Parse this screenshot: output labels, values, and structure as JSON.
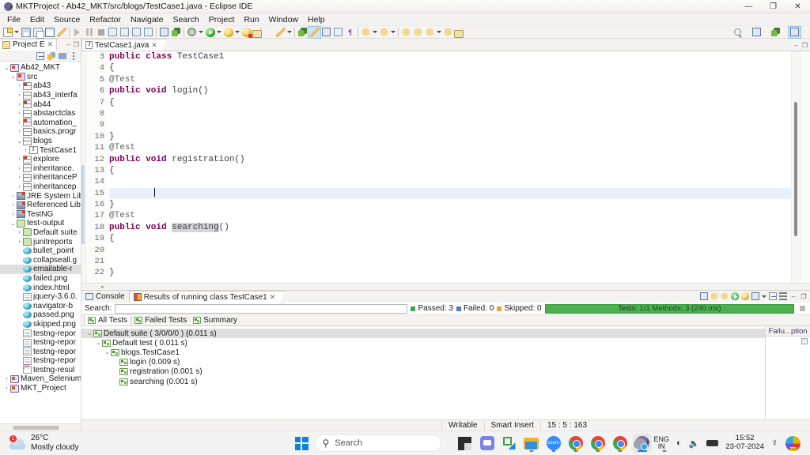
{
  "window": {
    "title": "MKTProject  -  Ab42_MKT/src/blogs/TestCase1.java  -  Eclipse IDE",
    "icon": "eclipse-icon",
    "minimize": "—",
    "restore": "❐",
    "close": "✕"
  },
  "menubar": {
    "items": [
      {
        "label": "File"
      },
      {
        "label": "Edit"
      },
      {
        "label": "Source"
      },
      {
        "label": "Refactor"
      },
      {
        "label": "Navigate"
      },
      {
        "label": "Search"
      },
      {
        "label": "Project"
      },
      {
        "label": "Run"
      },
      {
        "label": "Window"
      },
      {
        "label": "Help"
      }
    ]
  },
  "toolbar": {
    "groups": [
      {
        "items": [
          {
            "name": "new-wizard-icon",
            "kind": "doc",
            "arrow": true
          },
          {
            "name": "save-icon",
            "kind": "save"
          },
          {
            "name": "save-all-icon",
            "kind": "copy"
          },
          {
            "name": "toggle-window-icon",
            "kind": "win"
          },
          {
            "name": "print-icon",
            "kind": "pen"
          }
        ]
      },
      {
        "items": [
          {
            "name": "resume-icon",
            "kind": "play"
          },
          {
            "name": "suspend-icon",
            "kind": "pause"
          },
          {
            "name": "terminate-icon",
            "kind": "stop"
          },
          {
            "name": "step-into-icon",
            "kind": "box"
          },
          {
            "name": "step-over-icon",
            "kind": "box"
          },
          {
            "name": "step-return-icon",
            "kind": "box"
          },
          {
            "name": "drop-to-frame-icon",
            "kind": "box"
          }
        ]
      },
      {
        "items": [
          {
            "name": "open-task-icon",
            "kind": "boxb"
          },
          {
            "name": "search-task-icon",
            "kind": "leaf"
          }
        ]
      },
      {
        "items": [
          {
            "name": "external-tools-icon",
            "kind": "gear",
            "arrow": true
          },
          {
            "name": "run-icon",
            "kind": "green",
            "arrow": true
          },
          {
            "name": "debug-icon",
            "kind": "bug",
            "arrow": true
          },
          {
            "name": "coverage-icon",
            "kind": "bug-red",
            "arrow": true
          }
        ]
      },
      {
        "items": [
          {
            "name": "new-java-project-icon",
            "kind": "fold"
          },
          {
            "name": "new-java-package-icon",
            "kind": "pen",
            "arrow": true
          }
        ]
      },
      {
        "items": [
          {
            "name": "new-class-icon",
            "kind": "leaf"
          },
          {
            "name": "new-interface-icon",
            "kind": "pen",
            "selected": true
          },
          {
            "name": "new-enum-icon",
            "kind": "boxb"
          },
          {
            "name": "new-annotation-icon",
            "kind": "box"
          },
          {
            "name": "new-source-folder-icon",
            "kind": "t",
            "glyph": "¶"
          }
        ]
      },
      {
        "items": [
          {
            "name": "open-type-icon",
            "kind": "arrow-y",
            "arrow": true
          },
          {
            "name": "search-declaration-icon",
            "kind": "arrow-y",
            "arrow": true
          }
        ]
      },
      {
        "items": [
          {
            "name": "previous-annotation-icon",
            "kind": "arrow-y"
          },
          {
            "name": "next-annotation-icon",
            "kind": "arrow-y"
          },
          {
            "name": "back-icon",
            "kind": "arrow-y",
            "arrow": true
          },
          {
            "name": "forward-icon",
            "kind": "arrow-y",
            "arrow": true
          }
        ]
      },
      {
        "items": [
          {
            "name": "new-window-icon",
            "kind": "fold"
          }
        ]
      }
    ],
    "right": [
      {
        "name": "quick-access-search-icon",
        "kind": "mag"
      },
      {
        "name": "open-perspective-icon",
        "kind": "boxb"
      },
      {
        "name": "java-perspective-icon",
        "kind": "leaf"
      },
      {
        "name": "java-ee-perspective-icon",
        "kind": "boxb",
        "selected": true
      }
    ]
  },
  "explorer": {
    "tab": {
      "label": "Project E",
      "icon": "project-explorer-icon",
      "close": "✕"
    },
    "view_controls": [
      {
        "name": "minimize-view-icon",
        "glyph": "–"
      },
      {
        "name": "maximize-view-icon",
        "glyph": "❐"
      }
    ],
    "view_toolbar": [
      {
        "name": "collapse-all-icon",
        "kind": "collapse"
      },
      {
        "name": "link-with-editor-icon",
        "kind": "link"
      },
      {
        "name": "view-filters-icon",
        "kind": "filter"
      },
      {
        "name": "view-menu-icon",
        "kind": "vmenu"
      }
    ],
    "tree": [
      {
        "indent": 0,
        "twist": "v",
        "icon": "i-proj",
        "label": "Ab42_MKT"
      },
      {
        "indent": 1,
        "twist": "v",
        "icon": "i-src",
        "label": "src"
      },
      {
        "indent": 2,
        "twist": ">",
        "icon": "i-pkg hasred",
        "label": "ab43"
      },
      {
        "indent": 2,
        "twist": ">",
        "icon": "i-pkg",
        "label": "ab43_interfa"
      },
      {
        "indent": 2,
        "twist": ">",
        "icon": "i-pkg hasred",
        "label": "ab44"
      },
      {
        "indent": 2,
        "twist": ">",
        "icon": "i-pkg",
        "label": "abstarctclas"
      },
      {
        "indent": 2,
        "twist": ">",
        "icon": "i-pkg hasred",
        "label": "automation_"
      },
      {
        "indent": 2,
        "twist": ">",
        "icon": "i-pkg y",
        "label": "basics.progr"
      },
      {
        "indent": 2,
        "twist": "v",
        "icon": "i-pkg",
        "label": "blogs"
      },
      {
        "indent": 3,
        "twist": ">",
        "icon": "i-java",
        "label": "TestCase1"
      },
      {
        "indent": 2,
        "twist": ">",
        "icon": "i-pkg hasred",
        "label": "explore"
      },
      {
        "indent": 2,
        "twist": ">",
        "icon": "i-pkg",
        "label": "inheritance."
      },
      {
        "indent": 2,
        "twist": ">",
        "icon": "i-pkg",
        "label": "inheritanceP"
      },
      {
        "indent": 2,
        "twist": ">",
        "icon": "i-pkg",
        "label": "inheritancep"
      },
      {
        "indent": 1,
        "twist": ">",
        "icon": "i-lib",
        "label": "JRE System Libr"
      },
      {
        "indent": 1,
        "twist": ">",
        "icon": "i-lib",
        "label": "Referenced Lib"
      },
      {
        "indent": 1,
        "twist": ">",
        "icon": "i-lib",
        "label": "TestNG"
      },
      {
        "indent": 1,
        "twist": "v",
        "icon": "i-folder green",
        "label": "test-output"
      },
      {
        "indent": 2,
        "twist": ">",
        "icon": "i-folder green",
        "label": "Default suite"
      },
      {
        "indent": 2,
        "twist": ">",
        "icon": "i-folder green",
        "label": "junitreports"
      },
      {
        "indent": 2,
        "twist": "",
        "icon": "i-png",
        "label": "bullet_point"
      },
      {
        "indent": 2,
        "twist": "",
        "icon": "i-png",
        "label": "collapseall.g"
      },
      {
        "indent": 2,
        "twist": "",
        "icon": "i-png",
        "label": "emailable-r",
        "selected": true
      },
      {
        "indent": 2,
        "twist": "",
        "icon": "i-png",
        "label": "failed.png"
      },
      {
        "indent": 2,
        "twist": "",
        "icon": "i-png",
        "label": "index.html"
      },
      {
        "indent": 2,
        "twist": "",
        "icon": "i-html",
        "label": "jquery-3.6.0."
      },
      {
        "indent": 2,
        "twist": "",
        "icon": "i-png",
        "label": "navigator-b"
      },
      {
        "indent": 2,
        "twist": "",
        "icon": "i-png",
        "label": "passed.png"
      },
      {
        "indent": 2,
        "twist": "",
        "icon": "i-png",
        "label": "skipped.png"
      },
      {
        "indent": 2,
        "twist": "",
        "icon": "i-html",
        "label": "testng-repor"
      },
      {
        "indent": 2,
        "twist": "",
        "icon": "i-html",
        "label": "testng-repor"
      },
      {
        "indent": 2,
        "twist": "",
        "icon": "i-html",
        "label": "testng-repor"
      },
      {
        "indent": 2,
        "twist": "",
        "icon": "i-html",
        "label": "testng-repor"
      },
      {
        "indent": 2,
        "twist": "",
        "icon": "i-xml",
        "label": "testng-resul"
      },
      {
        "indent": 0,
        "twist": ">",
        "icon": "i-proj",
        "label": "Maven_Selenium"
      },
      {
        "indent": 0,
        "twist": ">",
        "icon": "i-proj",
        "label": "MKT_Project"
      }
    ]
  },
  "editor": {
    "tab": {
      "label": "TestCase1.java",
      "icon": "java-file-icon",
      "close": "✕"
    },
    "view_controls": [
      {
        "name": "minimize-editor-icon",
        "glyph": "–"
      },
      {
        "name": "maximize-editor-icon",
        "glyph": "❐"
      }
    ],
    "first_line_number": 3,
    "lines": [
      {
        "n": 3,
        "fold": "",
        "tokens": [
          {
            "t": "public class ",
            "c": "kw"
          },
          {
            "t": "TestCase1",
            "c": "id"
          }
        ]
      },
      {
        "n": 4,
        "fold": "",
        "tokens": [
          {
            "t": "{",
            "c": "id"
          }
        ]
      },
      {
        "n": 5,
        "fold": "●",
        "tokens": [
          {
            "t": "@Test",
            "c": "ann"
          }
        ]
      },
      {
        "n": 6,
        "fold": "",
        "tokens": [
          {
            "t": "public void ",
            "c": "kw"
          },
          {
            "t": "login()",
            "c": "id"
          }
        ]
      },
      {
        "n": 7,
        "fold": "",
        "tokens": [
          {
            "t": "{",
            "c": "id"
          }
        ]
      },
      {
        "n": 8,
        "fold": "",
        "tokens": []
      },
      {
        "n": 9,
        "fold": "",
        "tokens": []
      },
      {
        "n": 10,
        "fold": "",
        "tokens": [
          {
            "t": "}",
            "c": "id"
          }
        ]
      },
      {
        "n": 11,
        "fold": "●",
        "tokens": [
          {
            "t": "@Test",
            "c": "ann"
          }
        ]
      },
      {
        "n": 12,
        "fold": "",
        "tokens": [
          {
            "t": "public void ",
            "c": "kw"
          },
          {
            "t": "registration()",
            "c": "id"
          }
        ]
      },
      {
        "n": 13,
        "fold": "",
        "tokens": [
          {
            "t": "{",
            "c": "id"
          }
        ]
      },
      {
        "n": 14,
        "fold": "",
        "tokens": []
      },
      {
        "n": 15,
        "fold": "",
        "tokens": [],
        "current": true,
        "cursor": true
      },
      {
        "n": 16,
        "fold": "",
        "tokens": [
          {
            "t": "}",
            "c": "id"
          }
        ]
      },
      {
        "n": 17,
        "fold": "●",
        "tokens": [
          {
            "t": "@Test",
            "c": "ann"
          }
        ]
      },
      {
        "n": 18,
        "fold": "",
        "tokens": [
          {
            "t": "public void ",
            "c": "kw"
          },
          {
            "t": "searching",
            "c": "id hl"
          },
          {
            "t": "()",
            "c": "id"
          }
        ]
      },
      {
        "n": 19,
        "fold": "",
        "tokens": [
          {
            "t": "{",
            "c": "id"
          }
        ]
      },
      {
        "n": 20,
        "fold": "",
        "tokens": []
      },
      {
        "n": 21,
        "fold": "",
        "tokens": []
      },
      {
        "n": 22,
        "fold": "",
        "tokens": [
          {
            "t": "}",
            "c": "id"
          }
        ]
      }
    ]
  },
  "console": {
    "tabs": [
      {
        "label": "Console",
        "icon": "console-icon",
        "active": false,
        "close": ""
      },
      {
        "label": "Results of running class TestCase1",
        "icon": "testng-icon",
        "active": true,
        "close": "✕"
      }
    ],
    "toolbar": [
      {
        "name": "open-report-icon",
        "kind": "boxb"
      },
      {
        "name": "next-failed-test-icon",
        "kind": "arrow-down"
      },
      {
        "name": "previous-failed-test-icon",
        "kind": "arrow-up"
      },
      {
        "name": "rerun-test-icon",
        "kind": "green"
      },
      {
        "name": "rerun-failed-tests-icon",
        "kind": "bug"
      },
      {
        "name": "show-failures-icon",
        "kind": "boxb",
        "arrow": true
      },
      {
        "name": "minimize-console-icon",
        "kind": "collapse"
      },
      {
        "name": "view-menu-icon",
        "kind": "vmenu"
      },
      {
        "name": "restore-console-icon",
        "glyph": "–"
      },
      {
        "name": "maximize-console-icon",
        "glyph": "❐"
      }
    ],
    "search": {
      "label": "Search:",
      "value": "",
      "placeholder": ""
    },
    "stats": [
      {
        "label": "Passed: 3",
        "color": "#3aa84a"
      },
      {
        "label": "Failed: 0",
        "color": "#4a7fc1"
      },
      {
        "label": "Skipped: 0",
        "color": "#e0a82e"
      }
    ],
    "progress": {
      "label": "Tests: 1/1  Methods: 3 (240 ms)",
      "color": "#4caf50",
      "percent": 100
    },
    "tabs2": [
      {
        "label": "All Tests",
        "active": true
      },
      {
        "label": "Failed Tests",
        "active": false
      },
      {
        "label": "Summary",
        "active": false
      }
    ],
    "tree": [
      {
        "indent": 0,
        "twist": "v",
        "label": "Default suite ( 3/0/0/0 ) (0.011 s)",
        "selected": true
      },
      {
        "indent": 1,
        "twist": "v",
        "label": "Default test ( 0.011 s)"
      },
      {
        "indent": 2,
        "twist": "v",
        "label": "blogs.TestCase1"
      },
      {
        "indent": 3,
        "twist": "",
        "label": "login  (0.009 s)"
      },
      {
        "indent": 3,
        "twist": "",
        "label": "registration  (0.001 s)"
      },
      {
        "indent": 3,
        "twist": "",
        "label": "searching  (0.001 s)"
      }
    ],
    "table": {
      "header": "Failu...ption"
    }
  },
  "statusbar": {
    "cells": [
      {
        "label": ""
      },
      {
        "label": "Writable"
      },
      {
        "label": "Smart Insert"
      },
      {
        "label": "15 : 5 : 163"
      }
    ]
  },
  "taskbar": {
    "weather": {
      "temp": "26°C",
      "desc": "Mostly cloudy",
      "badge": "1",
      "icon": "cloud-icon"
    },
    "start": {
      "name": "windows-start-icon"
    },
    "search": {
      "placeholder": "Search",
      "icon": "search-icon"
    },
    "apps": [
      {
        "name": "widgets-icon",
        "kind": "a-widget",
        "running": false,
        "active": false
      },
      {
        "name": "teams-icon",
        "kind": "a-teams",
        "running": false,
        "active": false
      },
      {
        "name": "snipping-tool-icon",
        "kind": "a-green",
        "running": false,
        "active": false
      },
      {
        "name": "file-explorer-icon",
        "kind": "a-files",
        "running": true,
        "active": false
      },
      {
        "name": "zoom-icon",
        "kind": "a-zoom",
        "running": true,
        "active": false,
        "glyph": "zoom"
      },
      {
        "name": "chrome-icon",
        "kind": "a-chrome",
        "running": true,
        "active": false
      },
      {
        "name": "chrome-icon",
        "kind": "a-chrome",
        "running": true,
        "active": false
      },
      {
        "name": "chrome-profile-icon",
        "kind": "a-chrome",
        "running": true,
        "active": false
      },
      {
        "name": "eclipse-icon",
        "kind": "a-eclipse",
        "running": true,
        "active": true
      },
      {
        "name": "slack-icon",
        "kind": "a-slack",
        "running": true,
        "active": false
      }
    ],
    "tray": {
      "cloud": {
        "name": "onedrive-icon"
      },
      "language": {
        "line1": "ENG",
        "line2": "IN"
      },
      "wifi": {
        "name": "wifi-icon",
        "glyph": "◔"
      },
      "volume": {
        "name": "volume-muted-icon",
        "glyph": "⏚"
      },
      "battery": {
        "name": "battery-icon"
      },
      "clock": {
        "time": "15:52",
        "date": "23-07-2024"
      },
      "notifications": {
        "name": "notification-bell-icon",
        "glyph": "○"
      },
      "printer": {
        "name": "print-app-icon"
      },
      "chevron": {
        "name": "show-hidden-icons-icon"
      }
    }
  }
}
